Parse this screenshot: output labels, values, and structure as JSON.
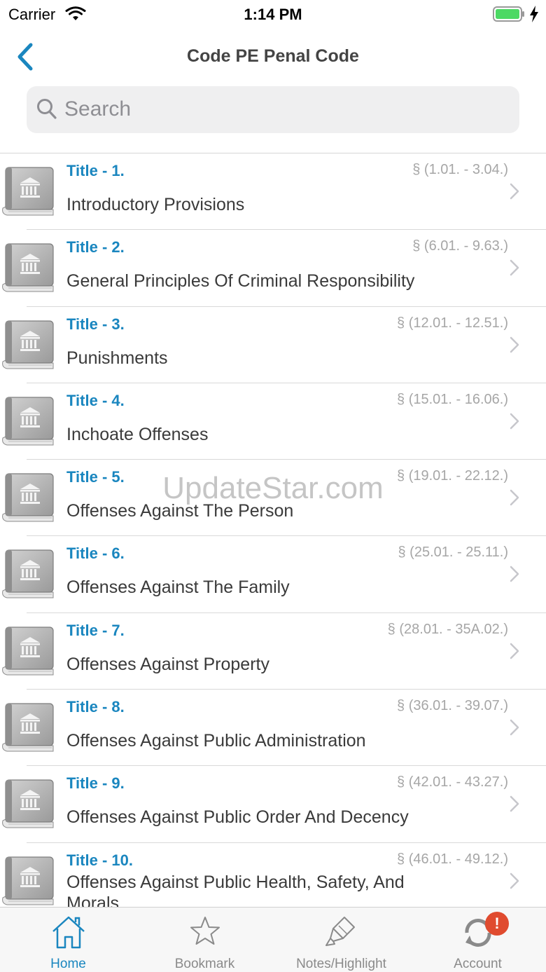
{
  "status_bar": {
    "carrier": "Carrier",
    "time": "1:14 PM",
    "battery_color": "#4cd964"
  },
  "nav": {
    "title": "Code PE Penal Code",
    "back_icon": "chevron-left-icon",
    "accent_color": "#1a86bf"
  },
  "search": {
    "placeholder": "Search",
    "value": ""
  },
  "titles": [
    {
      "title": "Title - 1.",
      "range": "§ (1.01. - 3.04.)",
      "name": "Introductory Provisions"
    },
    {
      "title": "Title - 2.",
      "range": "§ (6.01. - 9.63.)",
      "name": "General Principles Of Criminal Responsibility"
    },
    {
      "title": "Title - 3.",
      "range": "§ (12.01. - 12.51.)",
      "name": "Punishments"
    },
    {
      "title": "Title - 4.",
      "range": "§ (15.01. - 16.06.)",
      "name": "Inchoate Offenses"
    },
    {
      "title": "Title - 5.",
      "range": "§ (19.01. - 22.12.)",
      "name": "Offenses Against The Person"
    },
    {
      "title": "Title - 6.",
      "range": "§ (25.01. - 25.11.)",
      "name": "Offenses Against The Family"
    },
    {
      "title": "Title - 7.",
      "range": "§ (28.01. - 35A.02.)",
      "name": "Offenses Against Property"
    },
    {
      "title": "Title - 8.",
      "range": "§ (36.01. - 39.07.)",
      "name": "Offenses Against Public Administration"
    },
    {
      "title": "Title - 9.",
      "range": "§ (42.01. - 43.27.)",
      "name": "Offenses Against Public Order And Decency"
    },
    {
      "title": "Title - 10.",
      "range": "§ (46.01. - 49.12.)",
      "name": "Offenses Against Public Health, Safety, And Morals"
    }
  ],
  "watermark": "UpdateStar.com",
  "tab_bar": {
    "tabs": [
      {
        "label": "Home",
        "icon": "home-icon",
        "active": true
      },
      {
        "label": "Bookmark",
        "icon": "star-icon",
        "active": false
      },
      {
        "label": "Notes/Highlight",
        "icon": "highlighter-icon",
        "active": false
      },
      {
        "label": "Account",
        "icon": "sync-icon",
        "active": false
      }
    ],
    "badge": "!",
    "badge_color": "#e04b2f"
  }
}
